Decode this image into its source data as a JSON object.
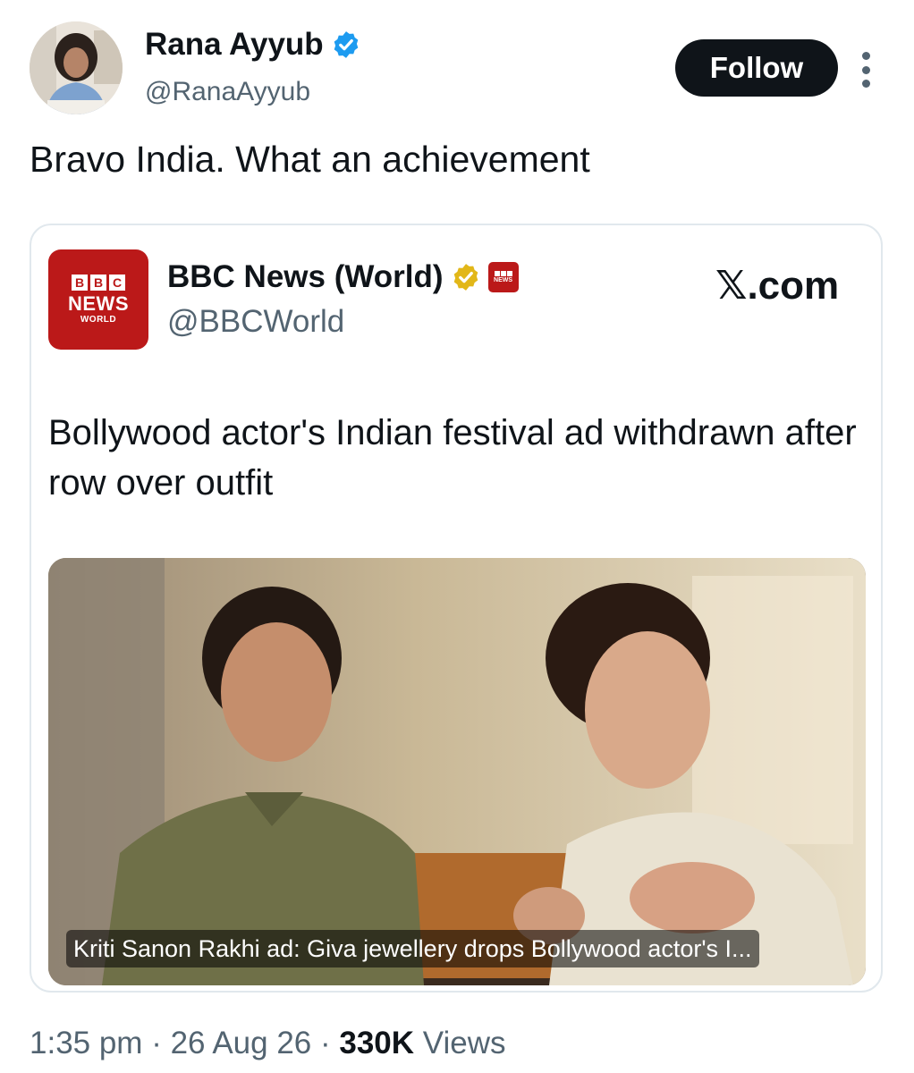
{
  "author": {
    "name": "Rana Ayyub",
    "handle": "@RanaAyyub",
    "follow_label": "Follow"
  },
  "tweet": {
    "text": "Bravo India. What an achievement"
  },
  "quoted": {
    "logo": {
      "blocks": [
        "B",
        "B",
        "C"
      ],
      "news": "NEWS",
      "world": "WORLD"
    },
    "name": "BBC News (World)",
    "handle": "@BBCWorld",
    "source": "𝕏.com",
    "headline": "Bollywood actor's Indian festival ad withdrawn after row over outfit",
    "media_caption": "Kriti Sanon Rakhi ad: Giva jewellery drops Bollywood actor's I...",
    "media_watermark": "NEWS"
  },
  "meta": {
    "time": "1:35 pm",
    "date": "26 Aug 26",
    "views_count": "330K",
    "views_label": "Views"
  },
  "colors": {
    "verified_blue": "#1d9bf0",
    "verified_gold": "#e2b719",
    "bbc_red": "#bb1919",
    "follow_bg": "#0f1419"
  },
  "icons": [
    "verified-icon",
    "gold-verified-icon",
    "more-icon"
  ]
}
